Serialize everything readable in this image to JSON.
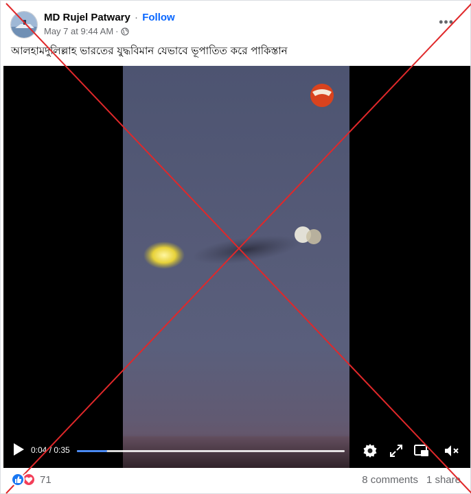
{
  "post": {
    "author": "MD Rujel Patwary",
    "separator": "·",
    "follow_label": "Follow",
    "timestamp": "May 7 at 9:44 AM",
    "meta_separator": "·",
    "audience_icon": "globe-icon",
    "more_label": "•••",
    "caption": "আলহামদুলিল্লাহ ভারতের যুদ্ধবিমান যেভাবে  ভূপাতিত করে পাকিস্তান"
  },
  "video": {
    "current_time": "0:04",
    "duration": "0:35",
    "time_display": "0:04 / 0:35",
    "progress_fraction": 0.114,
    "icons": [
      "play-icon",
      "settings-icon",
      "fullscreen-icon",
      "pip-icon",
      "volume-muted-icon"
    ]
  },
  "footer": {
    "reaction_icons": [
      "like-reaction-icon",
      "love-reaction-icon"
    ],
    "reaction_count": "71",
    "comments": "8 comments",
    "shares": "1 share"
  },
  "colors": {
    "follow": "#0866ff",
    "meta": "#65676b",
    "cross": "#e0282a",
    "progress": "#4a8af4"
  }
}
